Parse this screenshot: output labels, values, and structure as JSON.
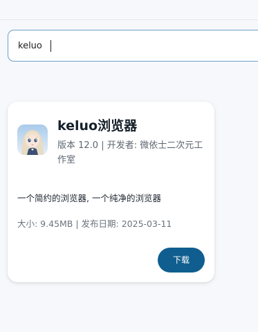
{
  "search": {
    "value": "keluo",
    "icon": "search-caret"
  },
  "result": {
    "title": "keluo浏览器",
    "meta": "版本 12.0 | 开发者: 微依士二次元工作室",
    "description": "一个简约的浏览器, 一个纯净的浏览器",
    "info": "大小: 9.45MB | 发布日期: 2025-03-11",
    "download_label": "下载",
    "icon": "anime-girl-app-icon"
  },
  "colors": {
    "accent": "#0f5e8f",
    "search_border": "#6f9fc8",
    "background": "#f6f8fc"
  }
}
